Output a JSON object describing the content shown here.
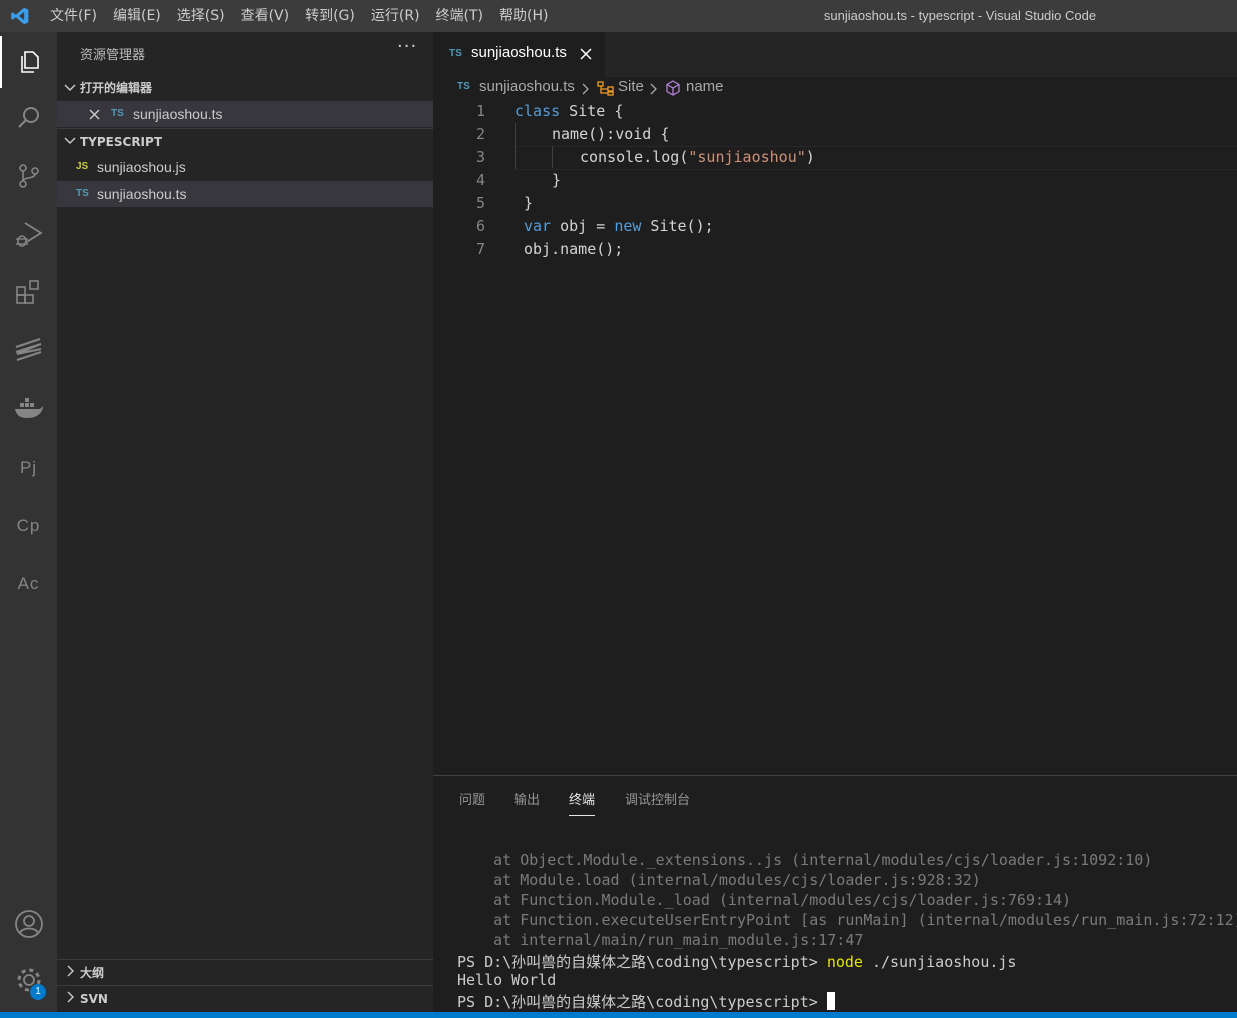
{
  "window": {
    "title": "sunjiaoshou.ts - typescript - Visual Studio Code"
  },
  "menu": [
    "文件(F)",
    "编辑(E)",
    "选择(S)",
    "查看(V)",
    "转到(G)",
    "运行(R)",
    "终端(T)",
    "帮助(H)"
  ],
  "activity_bar": {
    "items": [
      "explorer-icon",
      "search-icon",
      "source-control-icon",
      "run-debug-icon",
      "extensions-icon",
      "sublime-icon",
      "docker-icon"
    ],
    "text_items": [
      "Pj",
      "Cp",
      "Ac"
    ],
    "settings_badge": "1",
    "colors": {
      "active": "#ffffff",
      "inactive": "#858585",
      "badge": "#007acc"
    }
  },
  "sidebar": {
    "title": "资源管理器",
    "more": "···",
    "open_editors": {
      "header": "打开的编辑器",
      "items": [
        {
          "icon": "TS",
          "name": "sunjiaoshou.ts"
        }
      ]
    },
    "folder": {
      "header": "TYPESCRIPT",
      "items": [
        {
          "icon": "JS",
          "name": "sunjiaoshou.js"
        },
        {
          "icon": "TS",
          "name": "sunjiaoshou.ts"
        }
      ]
    },
    "outline": "大纲",
    "svn": "SVN"
  },
  "editor": {
    "tab": {
      "icon": "TS",
      "label": "sunjiaoshou.ts"
    },
    "breadcrumb": {
      "file_icon": "TS",
      "file": "sunjiaoshou.ts",
      "class": "Site",
      "method": "name"
    },
    "line_numbers": [
      "1",
      "2",
      "3",
      "4",
      "5",
      "6",
      "7"
    ],
    "lines": {
      "l1_kw": "class",
      "l1_rest": " Site {",
      "l2": "name():void {",
      "l3_pre": "console.log(",
      "l3_str": "\"sunjiaoshou\"",
      "l3_post": ")",
      "l4": "}",
      "l5": "}",
      "l6_kw": "var",
      "l6_mid": " obj = ",
      "l6_kw2": "new",
      "l6_rest": " Site();",
      "l7": "obj.name();"
    }
  },
  "panel": {
    "tabs": [
      "问题",
      "输出",
      "终端",
      "调试控制台"
    ],
    "active_tab": "终端",
    "terminal": {
      "trace": [
        "    at Object.Module._extensions..js (internal/modules/cjs/loader.js:1092:10)",
        "    at Module.load (internal/modules/cjs/loader.js:928:32)",
        "    at Function.Module._load (internal/modules/cjs/loader.js:769:14)",
        "    at Function.executeUserEntryPoint [as runMain] (internal/modules/run_main.js:72:12)",
        "    at internal/main/run_main_module.js:17:47"
      ],
      "prompt": "PS D:\\孙叫兽的自媒体之路\\coding\\typescript> ",
      "cmd_name": "node",
      "cmd_args": " ./sunjiaoshou.js",
      "output": "Hello World"
    }
  }
}
